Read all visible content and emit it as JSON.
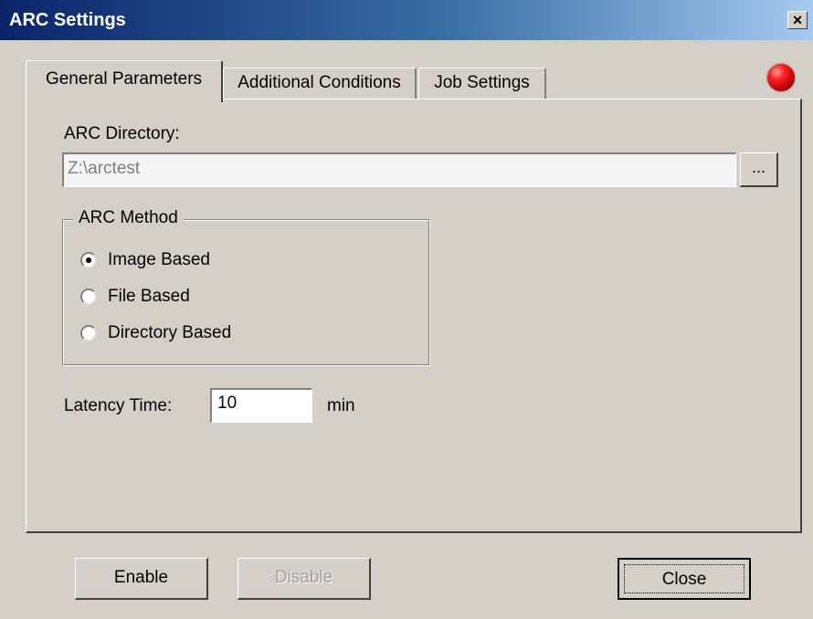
{
  "window": {
    "title": "ARC Settings",
    "close_glyph": "×"
  },
  "tabs": [
    {
      "label": "General Parameters",
      "active": true
    },
    {
      "label": "Additional Conditions",
      "active": false
    },
    {
      "label": "Job Settings",
      "active": false
    }
  ],
  "status": {
    "indicator_color": "#e00000",
    "icon": "status-led-icon"
  },
  "general": {
    "dir_label": "ARC Directory:",
    "dir_value": "Z:\\arctest",
    "browse_label": "...",
    "method_group_title": "ARC Method",
    "methods": [
      {
        "label": "Image Based",
        "selected": true
      },
      {
        "label": "File Based",
        "selected": false
      },
      {
        "label": "Directory Based",
        "selected": false
      }
    ],
    "latency_label": "Latency Time:",
    "latency_value": "10",
    "latency_unit": "min"
  },
  "buttons": {
    "enable": "Enable",
    "disable": "Disable",
    "close": "Close"
  },
  "colors": {
    "face": "#d4d0c8",
    "title_start": "#0a246a",
    "title_end": "#a6caf0"
  }
}
